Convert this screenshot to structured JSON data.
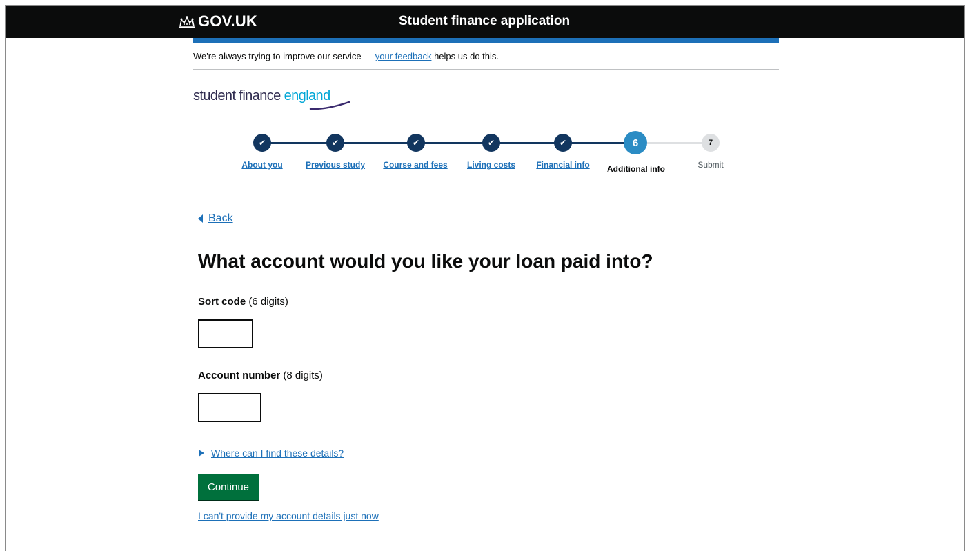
{
  "header": {
    "logo_text": "GOV.UK",
    "service_name": "Student finance application"
  },
  "feedback": {
    "prefix": "We're always trying to improve our service — ",
    "link_text": "your feedback",
    "suffix": " helps us do this."
  },
  "brand": {
    "part1": "student finance ",
    "part2": "england"
  },
  "stepper": {
    "steps": [
      {
        "label": "About you",
        "state": "done"
      },
      {
        "label": "Previous study",
        "state": "done"
      },
      {
        "label": "Course and fees",
        "state": "done"
      },
      {
        "label": "Living costs",
        "state": "done"
      },
      {
        "label": "Financial info",
        "state": "done"
      },
      {
        "label": "Additional info",
        "state": "current",
        "number": "6"
      },
      {
        "label": "Submit",
        "state": "todo",
        "number": "7"
      }
    ]
  },
  "back_link": "Back",
  "page_title": "What account would you like your loan paid into?",
  "form": {
    "sort_code_label": "Sort code",
    "sort_code_hint": " (6 digits)",
    "sort_code_value": "",
    "account_number_label": "Account number",
    "account_number_hint": " (8 digits)",
    "account_number_value": ""
  },
  "details_summary": "Where can I find these details?",
  "continue_button": "Continue",
  "cant_provide_link": "I can't provide my account details just now",
  "colors": {
    "header_bg": "#0b0c0c",
    "govuk_blue": "#1d70b8",
    "step_done": "#12365f",
    "step_current": "#2b8cc4",
    "button_green": "#00703c"
  }
}
